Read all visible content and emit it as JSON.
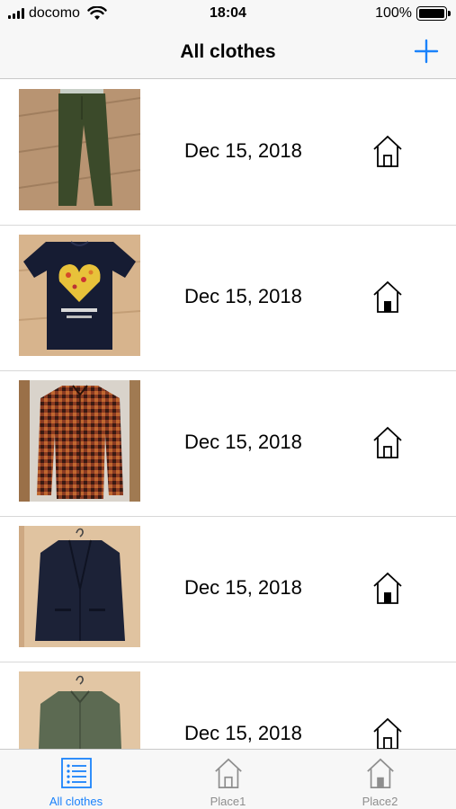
{
  "status_bar": {
    "carrier": "docomo",
    "time": "18:04",
    "battery": "100%",
    "battery_level": 1.0
  },
  "nav": {
    "title": "All clothes",
    "add_icon": "plus-icon"
  },
  "colors": {
    "accent": "#1a82fb",
    "inactive": "#8e8e8e"
  },
  "items": [
    {
      "date": "Dec 15, 2018",
      "photo": "green-pants",
      "home_icon": "home-outline-icon"
    },
    {
      "date": "Dec 15, 2018",
      "photo": "navy-tshirt",
      "home_icon": "home-filled-icon"
    },
    {
      "date": "Dec 15, 2018",
      "photo": "plaid-shirt",
      "home_icon": "home-outline-icon"
    },
    {
      "date": "Dec 15, 2018",
      "photo": "navy-jacket",
      "home_icon": "home-filled-icon"
    },
    {
      "date": "Dec 15, 2018",
      "photo": "green-shirt",
      "home_icon": "home-outline-icon"
    }
  ],
  "tabs": [
    {
      "label": "All clothes",
      "icon": "list-icon",
      "active": true
    },
    {
      "label": "Place1",
      "icon": "home-outline-icon",
      "active": false
    },
    {
      "label": "Place2",
      "icon": "home-filled-icon",
      "active": false
    }
  ]
}
